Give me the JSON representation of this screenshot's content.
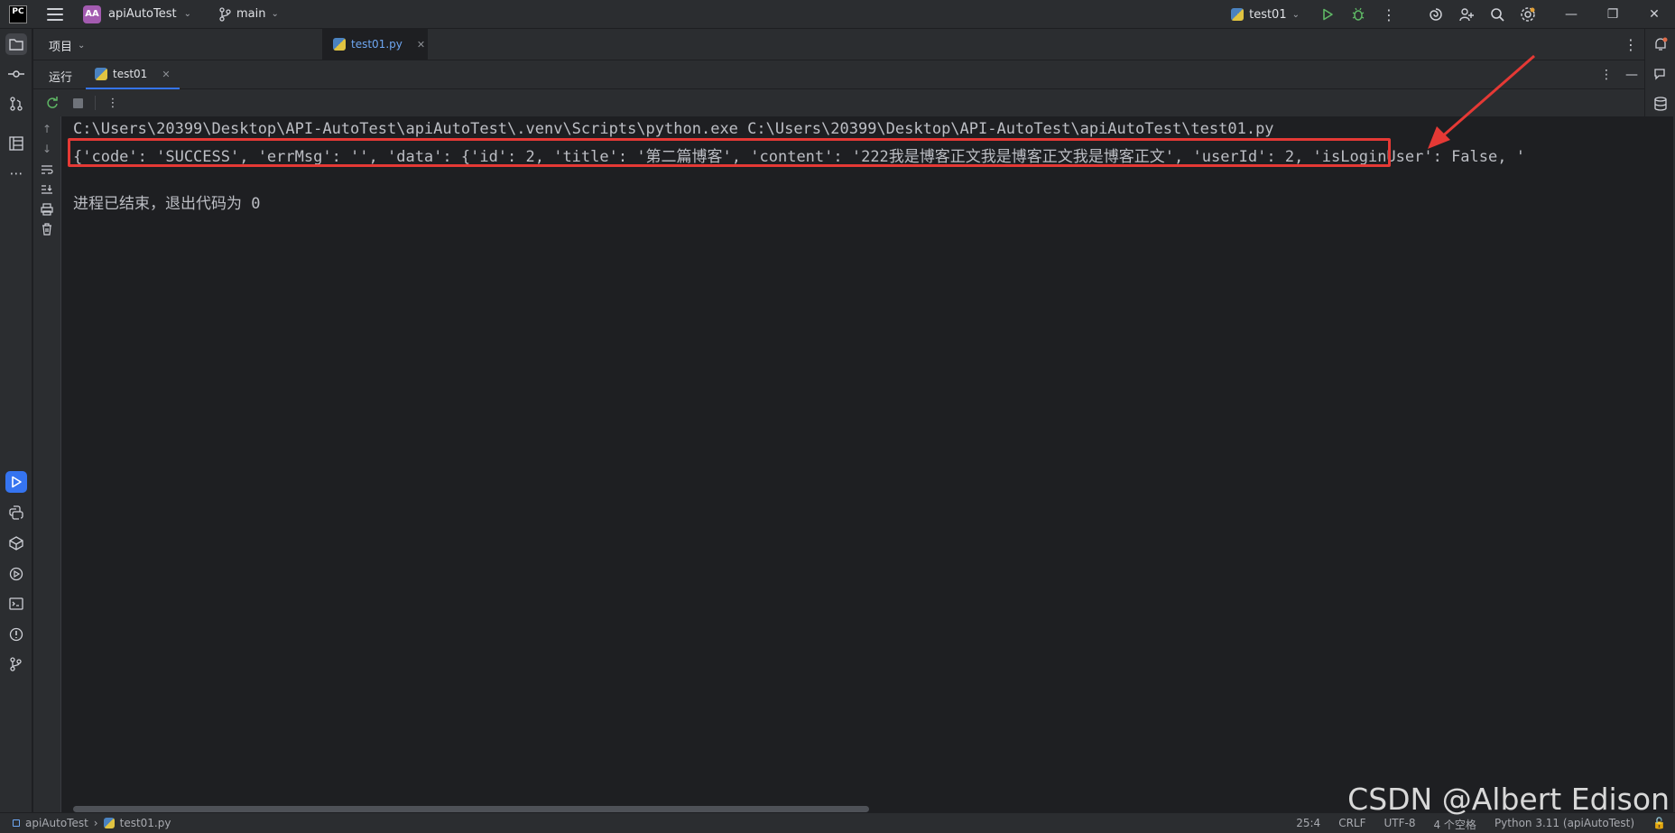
{
  "titlebar": {
    "logo_text": "PC",
    "project_badge": "AA",
    "project_name": "apiAutoTest",
    "branch": "main",
    "run_config": "test01"
  },
  "editor": {
    "project_tool_label": "项目",
    "open_file": "test01.py"
  },
  "run_panel": {
    "title": "运行",
    "tab_label": "test01"
  },
  "console": {
    "lines": [
      "C:\\Users\\20399\\Desktop\\API-AutoTest\\apiAutoTest\\.venv\\Scripts\\python.exe C:\\Users\\20399\\Desktop\\API-AutoTest\\apiAutoTest\\test01.py",
      "{'code': 'SUCCESS', 'errMsg': '', 'data': {'id': 2, 'title': '第二篇博客', 'content': '222我是博客正文我是博客正文我是博客正文', 'userId': 2, 'isLoginUser': False, '",
      "进程已结束，退出代码为 0"
    ]
  },
  "statusbar": {
    "crumb_project": "apiAutoTest",
    "crumb_file": "test01.py",
    "position": "25:4",
    "line_sep": "CRLF",
    "encoding": "UTF-8",
    "indent": "4 个空格",
    "interpreter": "Python 3.11 (apiAutoTest)"
  },
  "watermark": "CSDN @Albert Edison",
  "colors": {
    "accent": "#3574f0",
    "highlight": "#e53935",
    "background": "#1e1f22",
    "panel": "#2b2d30"
  }
}
